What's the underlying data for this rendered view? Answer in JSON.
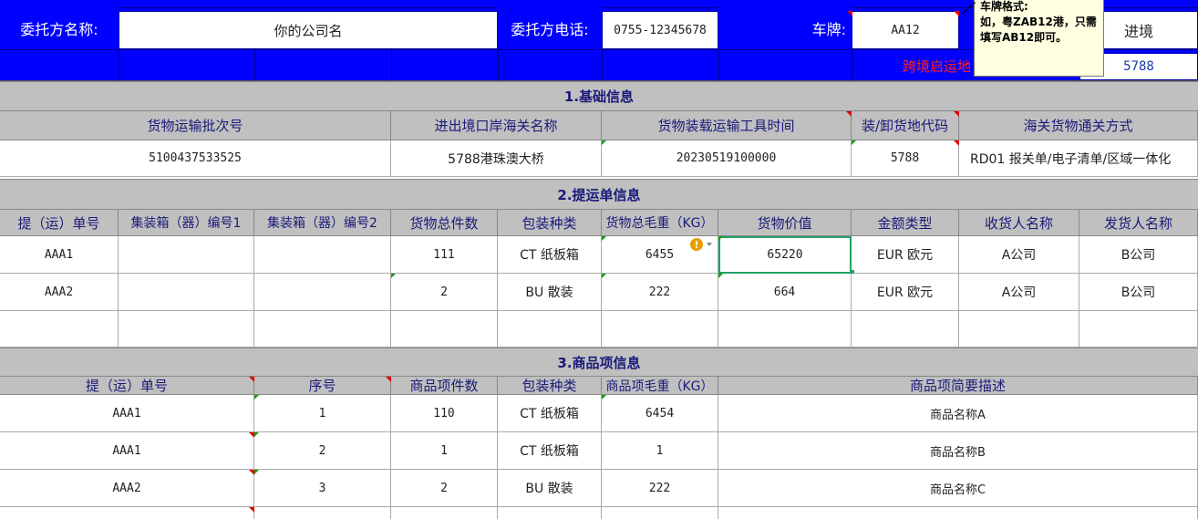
{
  "header": {
    "client_name_label": "委托方名称:",
    "client_name_value": "你的公司名",
    "client_phone_label": "委托方电话:",
    "client_phone_value": "0755-12345678",
    "plate_label": "车牌:",
    "plate_value": "AA12",
    "entry_label": "进境",
    "cross_border_label": "跨境启运地",
    "cross_border_code": "5788"
  },
  "comment": {
    "title": "车牌格式:",
    "body": "如，粤ZAB12港，只需填写AB12即可。"
  },
  "section1": {
    "title": "1.基础信息",
    "columns": [
      "货物运输批次号",
      "进出境口岸海关名称",
      "货物装载运输工具时间",
      "装/卸货地代码",
      "海关货物通关方式"
    ],
    "values": [
      "5100437533525",
      "5788港珠澳大桥",
      "20230519100000",
      "5788",
      "RD01 报关单/电子清单/区域一体化"
    ]
  },
  "section2": {
    "title": "2.提运单信息",
    "columns": [
      "提（运）单号",
      "集装箱（器）编号1",
      "集装箱（器）编号2",
      "货物总件数",
      "包装种类",
      "货物总毛重（KG）",
      "货物价值",
      "金额类型",
      "收货人名称",
      "发货人名称"
    ],
    "rows": [
      [
        "AAA1",
        "",
        "",
        "111",
        "CT 纸板箱",
        "6455",
        "65220",
        "EUR 欧元",
        "A公司",
        "B公司"
      ],
      [
        "AAA2",
        "",
        "",
        "2",
        "BU 散装",
        "222",
        "664",
        "EUR 欧元",
        "A公司",
        "B公司"
      ],
      [
        "",
        "",
        "",
        "",
        "",
        "",
        "",
        "",
        "",
        ""
      ]
    ]
  },
  "section3": {
    "title": "3.商品项信息",
    "columns": [
      "提（运）单号",
      "序号",
      "商品项件数",
      "包装种类",
      "商品项毛重（KG）",
      "商品项简要描述"
    ],
    "rows": [
      [
        "AAA1",
        "1",
        "110",
        "CT 纸板箱",
        "6454",
        "商品名称A"
      ],
      [
        "AAA1",
        "2",
        "1",
        "CT 纸板箱",
        "1",
        "商品名称B"
      ],
      [
        "AAA2",
        "3",
        "2",
        "BU 散装",
        "222",
        "商品名称C"
      ]
    ]
  },
  "colors": {
    "header_blue": "#0000ff",
    "section_gray": "#c0c0c0",
    "selection_green": "#21a366",
    "warning_orange": "#e8a000"
  },
  "icons": {
    "error_check": "warning-icon"
  }
}
